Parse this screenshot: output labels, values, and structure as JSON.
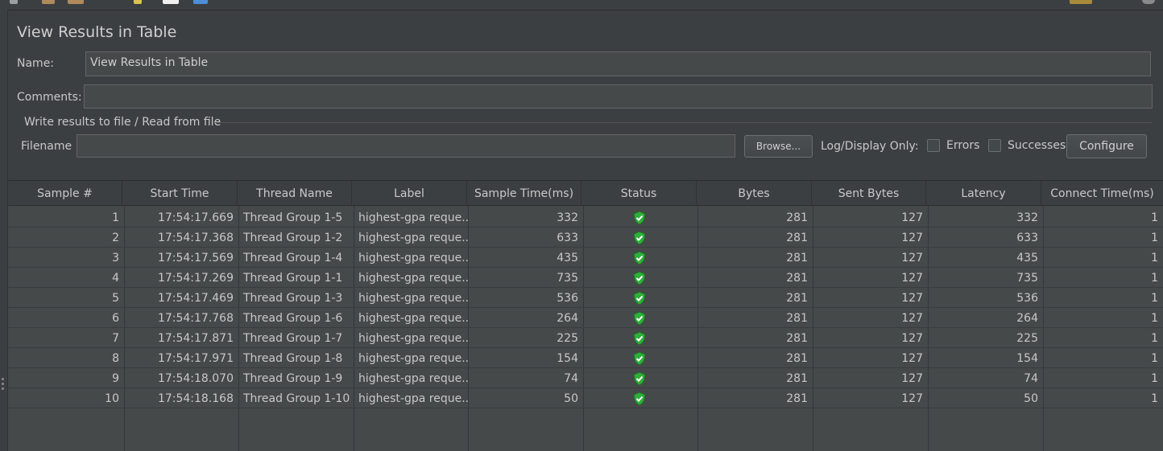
{
  "panel": {
    "title": "View Results in Table",
    "name_label": "Name:",
    "name_value": "View Results in Table",
    "comments_label": "Comments:",
    "comments_value": "",
    "file_group_title": "Write results to file / Read from file",
    "filename_label": "Filename",
    "filename_value": "",
    "browse_label": "Browse...",
    "log_display_label": "Log/Display Only:",
    "errors_label": "Errors",
    "errors_checked": false,
    "successes_label": "Successes",
    "successes_checked": false,
    "configure_label": "Configure"
  },
  "table": {
    "columns": [
      "Sample #",
      "Start Time",
      "Thread Name",
      "Label",
      "Sample Time(ms)",
      "Status",
      "Bytes",
      "Sent Bytes",
      "Latency",
      "Connect Time(ms)"
    ],
    "rows": [
      {
        "sample": "1",
        "start": "17:54:17.669",
        "thread": "Thread Group  1-5",
        "label": "highest-gpa reque...",
        "time": "332",
        "status": "success-shield-icon",
        "bytes": "281",
        "sent": "127",
        "latency": "332",
        "connect": "1"
      },
      {
        "sample": "2",
        "start": "17:54:17.368",
        "thread": "Thread Group  1-2",
        "label": "highest-gpa reque...",
        "time": "633",
        "status": "success-shield-icon",
        "bytes": "281",
        "sent": "127",
        "latency": "633",
        "connect": "1"
      },
      {
        "sample": "3",
        "start": "17:54:17.569",
        "thread": "Thread Group  1-4",
        "label": "highest-gpa reque...",
        "time": "435",
        "status": "success-shield-icon",
        "bytes": "281",
        "sent": "127",
        "latency": "435",
        "connect": "1"
      },
      {
        "sample": "4",
        "start": "17:54:17.269",
        "thread": "Thread Group  1-1",
        "label": "highest-gpa reque...",
        "time": "735",
        "status": "success-shield-icon",
        "bytes": "281",
        "sent": "127",
        "latency": "735",
        "connect": "1"
      },
      {
        "sample": "5",
        "start": "17:54:17.469",
        "thread": "Thread Group  1-3",
        "label": "highest-gpa reque...",
        "time": "536",
        "status": "success-shield-icon",
        "bytes": "281",
        "sent": "127",
        "latency": "536",
        "connect": "1"
      },
      {
        "sample": "6",
        "start": "17:54:17.768",
        "thread": "Thread Group  1-6",
        "label": "highest-gpa reque...",
        "time": "264",
        "status": "success-shield-icon",
        "bytes": "281",
        "sent": "127",
        "latency": "264",
        "connect": "1"
      },
      {
        "sample": "7",
        "start": "17:54:17.871",
        "thread": "Thread Group  1-7",
        "label": "highest-gpa reque...",
        "time": "225",
        "status": "success-shield-icon",
        "bytes": "281",
        "sent": "127",
        "latency": "225",
        "connect": "1"
      },
      {
        "sample": "8",
        "start": "17:54:17.971",
        "thread": "Thread Group  1-8",
        "label": "highest-gpa reque...",
        "time": "154",
        "status": "success-shield-icon",
        "bytes": "281",
        "sent": "127",
        "latency": "154",
        "connect": "1"
      },
      {
        "sample": "9",
        "start": "17:54:18.070",
        "thread": "Thread Group  1-9",
        "label": "highest-gpa reque...",
        "time": "74",
        "status": "success-shield-icon",
        "bytes": "281",
        "sent": "127",
        "latency": "74",
        "connect": "1"
      },
      {
        "sample": "10",
        "start": "17:54:18.168",
        "thread": "Thread Group  1-10",
        "label": "highest-gpa reque...",
        "time": "50",
        "status": "success-shield-icon",
        "bytes": "281",
        "sent": "127",
        "latency": "50",
        "connect": "1"
      }
    ]
  },
  "colors": {
    "background": "#3c3f41",
    "field_bg": "#45494a",
    "text": "#c8c8c8",
    "success_green": "#2fae3a"
  }
}
